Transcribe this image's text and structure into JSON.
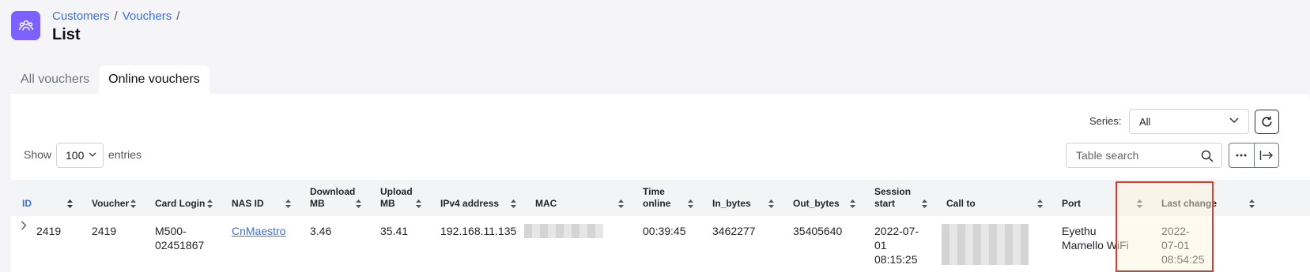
{
  "breadcrumb": {
    "items": [
      "Customers",
      "Vouchers"
    ],
    "separator": "/"
  },
  "page_title": "List",
  "tabs": [
    {
      "label": "All vouchers",
      "active": false
    },
    {
      "label": "Online vouchers",
      "active": true
    }
  ],
  "filters": {
    "series_label": "Series:",
    "series_value": "All",
    "show_label": "Show",
    "entries_value": "100",
    "entries_label": "entries",
    "search_placeholder": "Table search"
  },
  "table": {
    "columns": [
      "ID",
      "Voucher",
      "Card Login",
      "NAS ID",
      "Download MB",
      "Upload MB",
      "IPv4 address",
      "MAC",
      "Time online",
      "In_bytes",
      "Out_bytes",
      "Session start",
      "Call to",
      "Port",
      "Last change"
    ],
    "rows": [
      {
        "id": "2419",
        "voucher": "2419",
        "card_login": "M500-02451867",
        "nas_id": "CnMaestro",
        "download_mb": "3.46",
        "upload_mb": "35.41",
        "ipv4": "192.168.11.135",
        "time_online": "00:39:45",
        "in_bytes": "3462277",
        "out_bytes": "35405640",
        "session_start": "2022-07-01 08:15:25",
        "port": "Eyethu Mamello WiFi",
        "last_change": "2022-07-01 08:54:25"
      }
    ]
  },
  "colors": {
    "accent": "#7b61ff",
    "link": "#3c6fd8",
    "highlight": "#e03a30"
  }
}
